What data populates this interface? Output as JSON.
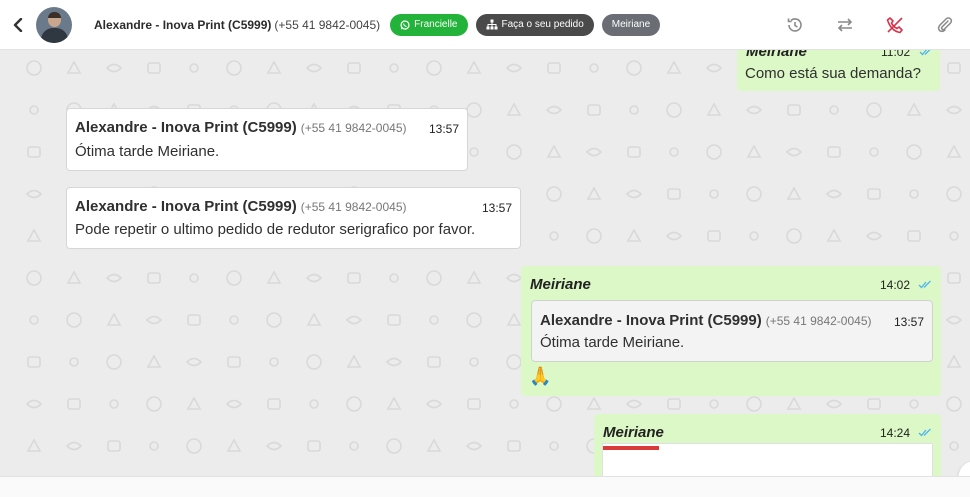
{
  "header": {
    "contact_name": "Alexandre - Inova Print (C5999)",
    "contact_phone": "(+55 41 9842-0045)",
    "tags": {
      "attendant": "Francielle",
      "order": "Faça o seu pedido",
      "agent": "Meiriane"
    }
  },
  "messages": {
    "m0": {
      "sender": "Meiriane",
      "time": "11:02",
      "text": "Como está sua demanda?"
    },
    "m1": {
      "sender": "Alexandre - Inova Print (C5999)",
      "phone": "(+55 41 9842-0045)",
      "time": "13:57",
      "text": "Ótima tarde Meiriane."
    },
    "m2": {
      "sender": "Alexandre - Inova Print (C5999)",
      "phone": "(+55 41 9842-0045)",
      "time": "13:57",
      "text": "Pode repetir o ultimo pedido de redutor serigrafico por favor."
    },
    "m3": {
      "sender": "Meiriane",
      "time": "14:02",
      "quote": {
        "sender": "Alexandre - Inova Print (C5999)",
        "phone": "(+55 41 9842-0045)",
        "time": "13:57",
        "text": "Ótima tarde Meiriane."
      },
      "text": "🙏"
    },
    "m4": {
      "sender": "Meiriane",
      "time": "14:24"
    }
  },
  "colors": {
    "incoming_bubble": "#ffffff",
    "outgoing_bubble": "#dcf8c6",
    "read_ticks": "#4fb6ec",
    "tag_green": "#23b33a",
    "call_icon": "#d6334b"
  },
  "icons": [
    "back-icon",
    "whatsapp-icon",
    "sitemap-icon",
    "history-icon",
    "transfer-icon",
    "end-call-icon",
    "attach-icon",
    "double-check-icon"
  ]
}
